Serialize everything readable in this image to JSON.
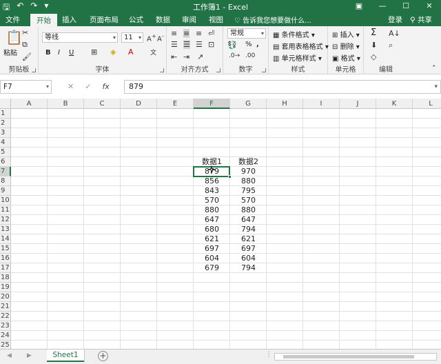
{
  "window": {
    "title": "工作簿1 - Excel",
    "qat_icons": [
      "save-icon",
      "undo-icon",
      "redo-icon"
    ],
    "accent": "#217346"
  },
  "ribbon_tabs": [
    {
      "label": "文件"
    },
    {
      "label": "开始"
    },
    {
      "label": "插入"
    },
    {
      "label": "页面布局"
    },
    {
      "label": "公式"
    },
    {
      "label": "数据"
    },
    {
      "label": "审阅"
    },
    {
      "label": "视图"
    }
  ],
  "tellme": "告诉我您想要做什么...",
  "login": "登录",
  "share": "共享",
  "ribbon": {
    "clipboard": {
      "label": "剪贴板",
      "paste": "粘贴"
    },
    "font": {
      "label": "字体",
      "font_name": "等线",
      "font_size": "11",
      "bold": "B",
      "italic": "I",
      "underline": "U"
    },
    "alignment": {
      "label": "对齐方式"
    },
    "number": {
      "label": "数字",
      "format": "常规",
      "percent": "%",
      "comma": ","
    },
    "styles": {
      "label": "样式",
      "conditional": "条件格式",
      "table": "套用表格格式",
      "cell_styles": "单元格样式"
    },
    "cells": {
      "label": "单元格",
      "insert": "插入",
      "delete": "删除",
      "format": "格式"
    },
    "editing": {
      "label": "编辑",
      "sum": "Σ"
    }
  },
  "formula_bar": {
    "name_box": "F7",
    "fx": "fx",
    "value": "879"
  },
  "columns": [
    "A",
    "B",
    "C",
    "D",
    "E",
    "F",
    "G",
    "H",
    "I",
    "J",
    "K",
    "L"
  ],
  "rows": [
    "1",
    "2",
    "3",
    "4",
    "5",
    "6",
    "7",
    "8",
    "9",
    "10",
    "11",
    "12",
    "13",
    "14",
    "15",
    "16",
    "17",
    "18",
    "19",
    "20",
    "21",
    "22",
    "23",
    "24",
    "25"
  ],
  "headers": {
    "F6": "数据1",
    "G6": "数据2"
  },
  "data1": [
    "879",
    "856",
    "843",
    "570",
    "880",
    "647",
    "680",
    "621",
    "697",
    "604",
    "679"
  ],
  "data2": [
    "970",
    "880",
    "795",
    "570",
    "880",
    "647",
    "794",
    "621",
    "697",
    "604",
    "794"
  ],
  "active_cell": "F7",
  "sheet_tab": "Sheet1"
}
